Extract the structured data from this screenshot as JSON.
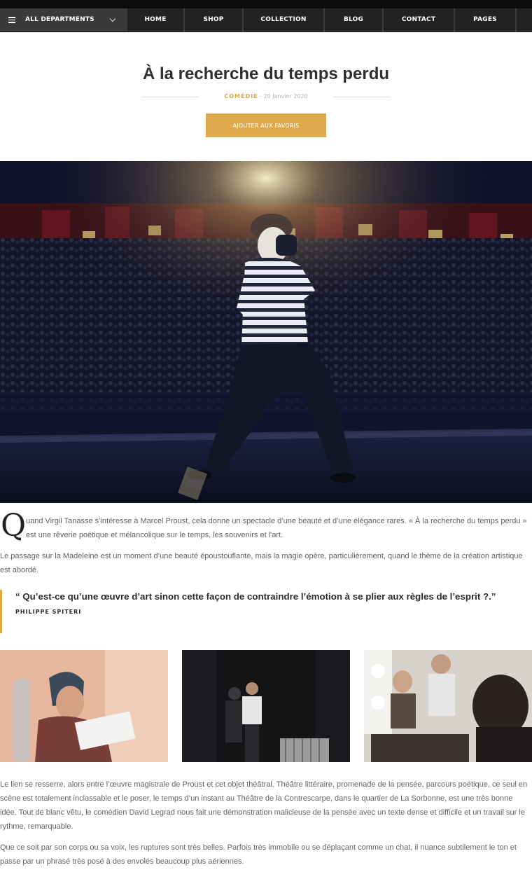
{
  "nav": {
    "departments_label": "ALL DEPARTMENTS",
    "items": [
      {
        "label": "HOME"
      },
      {
        "label": "SHOP"
      },
      {
        "label": "COLLECTION"
      },
      {
        "label": "BLOG"
      },
      {
        "label": "CONTACT"
      },
      {
        "label": "PAGES"
      }
    ]
  },
  "article": {
    "title": "À la recherche du temps perdu",
    "category": "COMÉDIE",
    "date": "- 20 Janvier 2020",
    "favorite_button": "AJOUTER AUX FAVORIS",
    "dropcap": "Q",
    "intro": "uand Virgil Tanasse s’intéresse à Marcel Proust, cela donne un spectacle d’une beauté et d’une élégance rares. « À la recherche du temps perdu » est une rêverie poétique et mélancolique sur le temps, les souvenirs et l'art.",
    "paragraph2": "Le passage sur la Madeleine est un moment d’une beauté époustouflante, mais la magie opère, particulièrement, quand le thème de la création artistique est abordé.",
    "quote": "“ Qu’est-ce qu’une œuvre d’art sinon cette façon de contraindre l’émotion à se plier aux règles de l’esprit ?.”",
    "quote_author": "PHILIPPE SPITERI",
    "paragraph3": "Le lien se resserre, alors entre l’œuvre magistrale de Proust et cet objet théâtral. Théâtre littéraire, promenade de la pensée, parcours poétique, ce seul en scène est totalement inclassable et le poser, le temps d’un instant au Théâtre de la Contrescarpe, dans le quartier de La Sorbonne, est une très bonne idée. Tout de blanc vêtu, le comédien David Legrad nous fait une démonstration malicieuse de la pensée avec un texte dense et difficile et un travail sur le rythme, remarquable.",
    "paragraph4": "Que ce soit par son corps ou sa voix, les ruptures sont très belles. Parfois très immobile ou se déplaçant comme un chat, il nuance subtilement le ton et passe par un phrasé très posé à des envolés beaucoup plus aériennes."
  },
  "colors": {
    "accent": "#deaa4c",
    "nav_bg": "#222222",
    "text": "#636363"
  }
}
